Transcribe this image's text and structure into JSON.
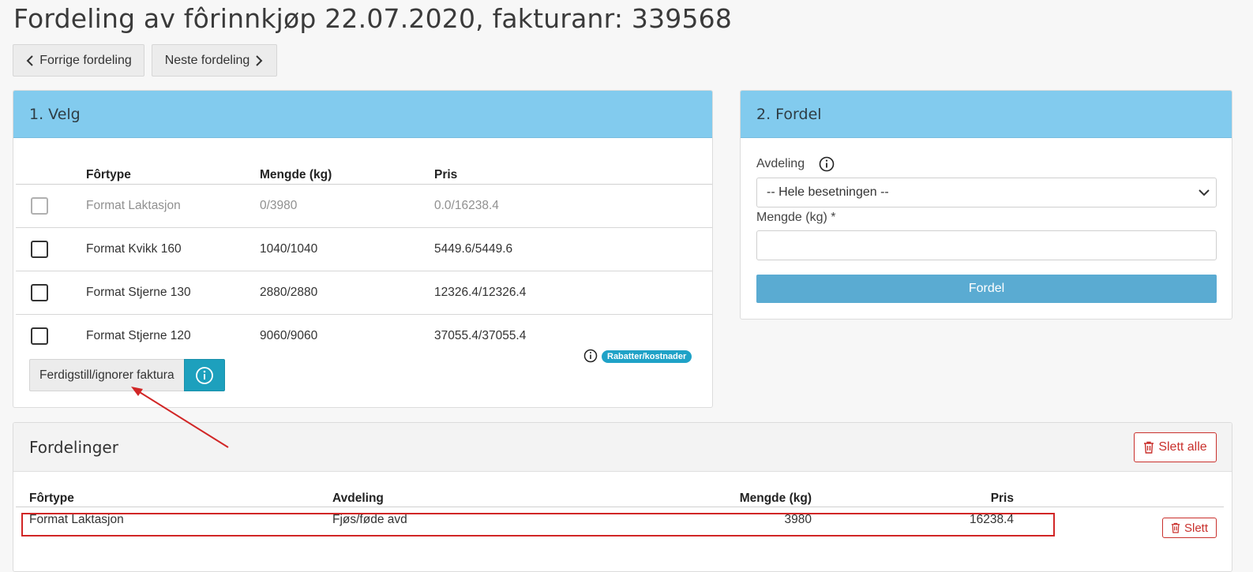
{
  "page": {
    "title": "Fordeling av fôrinnkjøp 22.07.2020, fakturanr: 339568"
  },
  "nav": {
    "prev_label": "Forrige fordeling",
    "next_label": "Neste fordeling"
  },
  "velg": {
    "header": "1. Velg",
    "columns": [
      "Fôrtype",
      "Mengde (kg)",
      "Pris"
    ],
    "rows": [
      {
        "fortype": "Format Laktasjon",
        "mengde": "0/3980",
        "pris": "0.0/16238.4",
        "disabled": true
      },
      {
        "fortype": "Format Kvikk 160",
        "mengde": "1040/1040",
        "pris": "5449.6/5449.6",
        "disabled": false
      },
      {
        "fortype": "Format Stjerne 130",
        "mengde": "2880/2880",
        "pris": "12326.4/12326.4",
        "disabled": false
      },
      {
        "fortype": "Format Stjerne 120",
        "mengde": "9060/9060",
        "pris": "37055.4/37055.4",
        "disabled": false
      }
    ],
    "badge": "Rabatter/kostnader",
    "ferdig_label": "Ferdigstill/ignorer faktura"
  },
  "fordel": {
    "header": "2. Fordel",
    "avdeling_label": "Avdeling",
    "avdeling_selected": "-- Hele besetningen --",
    "mengde_label": "Mengde (kg) *",
    "mengde_value": "",
    "button_label": "Fordel"
  },
  "fordelinger": {
    "header": "Fordelinger",
    "slett_alle_label": "Slett alle",
    "columns": [
      "Fôrtype",
      "Avdeling",
      "Mengde (kg)",
      "Pris"
    ],
    "rows": [
      {
        "fortype": "Format Laktasjon",
        "avdeling": "Fjøs/føde avd",
        "mengde": "3980",
        "pris": "16238.4",
        "slett_label": "Slett"
      }
    ]
  },
  "colors": {
    "header_blue": "#82cbee",
    "teal": "#1da0bd",
    "primary_button": "#5aabd2",
    "danger": "#c9302c",
    "annotation_red": "#d12626"
  }
}
